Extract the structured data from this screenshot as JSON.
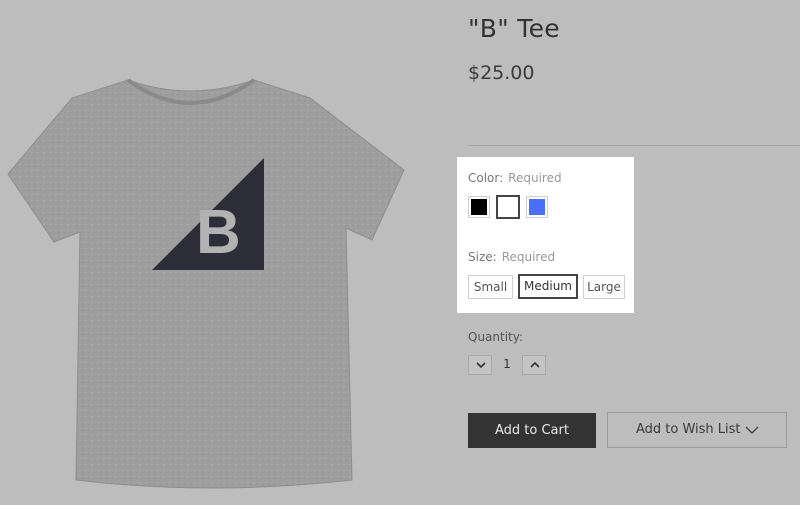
{
  "product": {
    "title": "\"B\" Tee",
    "price": "$25.00",
    "image_alt": "t-shirt-image"
  },
  "options": {
    "color": {
      "label": "Color:",
      "required": "Required",
      "swatches": [
        {
          "name": "black",
          "hex": "#000000",
          "selected": false
        },
        {
          "name": "white",
          "hex": "#ffffff",
          "selected": true
        },
        {
          "name": "blue",
          "hex": "#4a6ef5",
          "selected": false
        }
      ]
    },
    "size": {
      "label": "Size:",
      "required": "Required",
      "choices": [
        {
          "label": "Small",
          "selected": false
        },
        {
          "label": "Medium",
          "selected": true
        },
        {
          "label": "Large",
          "selected": false
        }
      ]
    }
  },
  "quantity": {
    "label": "Quantity:",
    "value": "1"
  },
  "actions": {
    "add_to_cart": "Add to Cart",
    "add_to_wish_list": "Add to Wish List"
  },
  "colors": {
    "overlay_bg": "#bdbdbd",
    "card_bg": "#ffffff",
    "cart_button_bg": "#333333",
    "logo_dark": "#2e2d3a"
  }
}
